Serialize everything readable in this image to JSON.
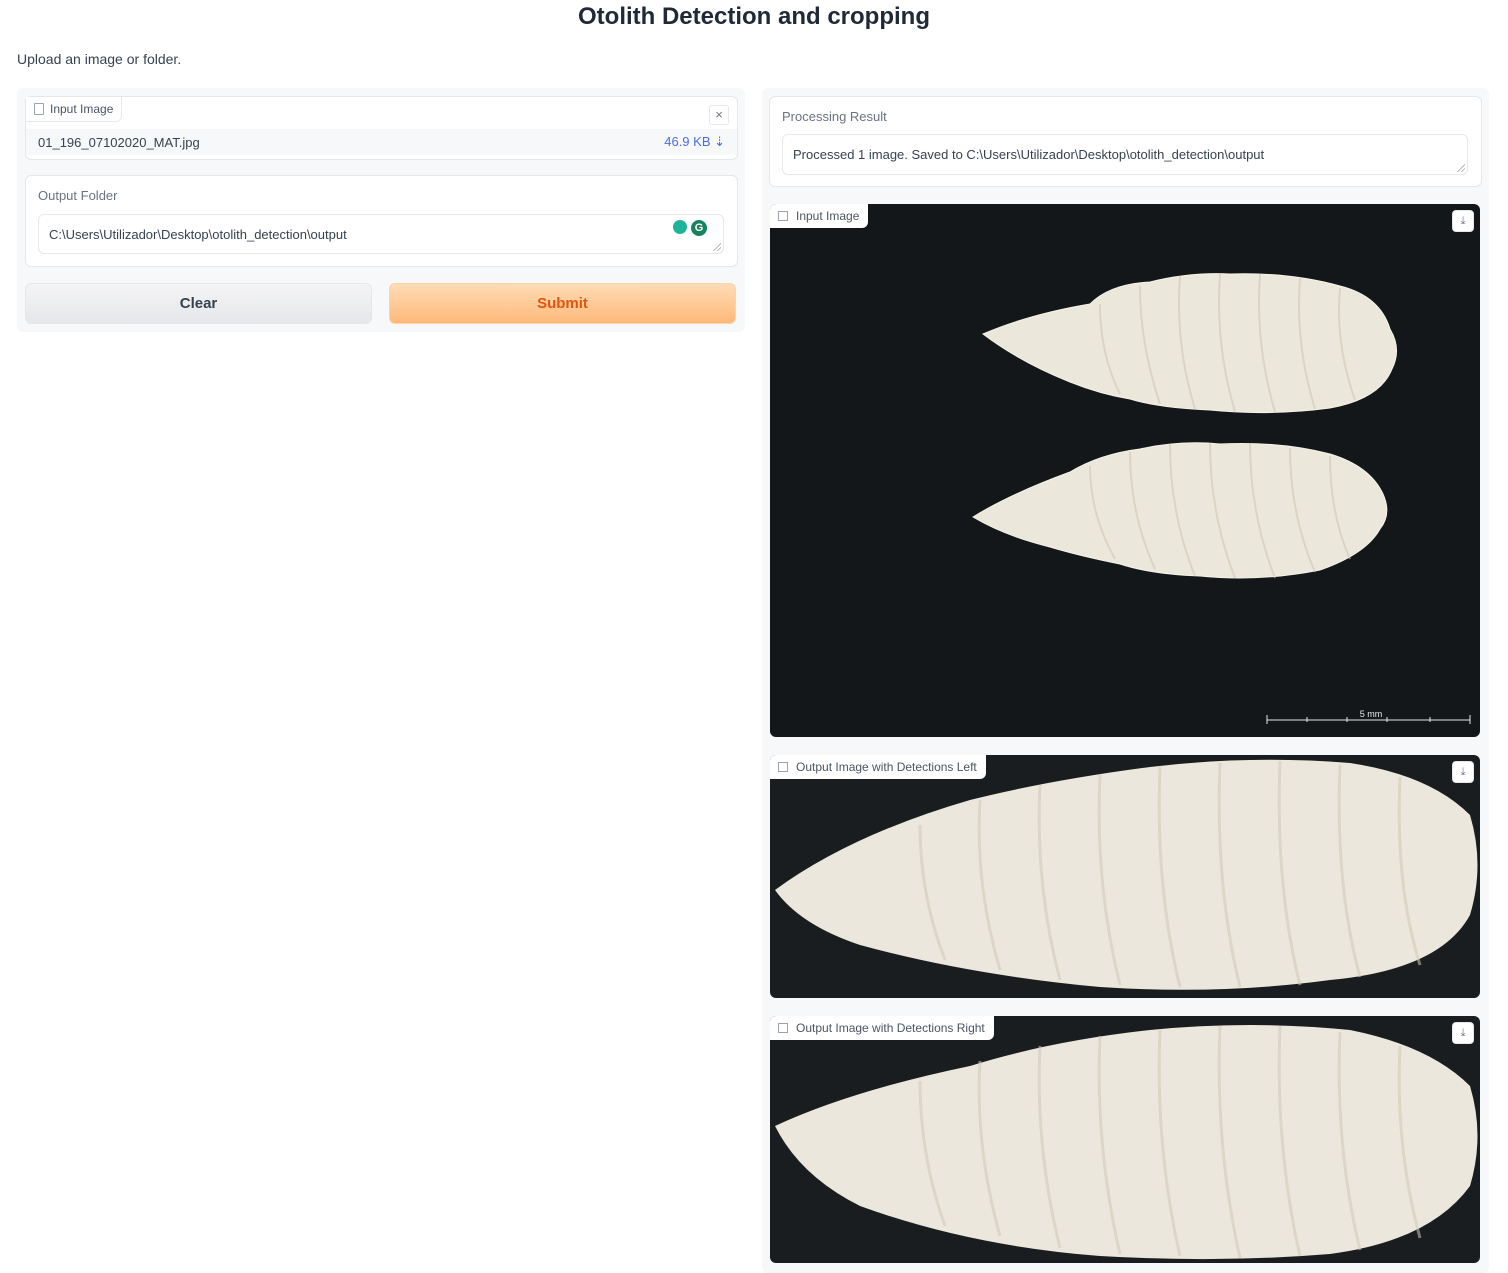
{
  "app": {
    "title": "Otolith Detection and cropping",
    "subtitle": "Upload an image or folder."
  },
  "input_image": {
    "label": "Input Image",
    "file_name": "01_196_07102020_MAT.jpg",
    "file_size": "46.9 KB ⇣",
    "close_glyph": "×"
  },
  "output_folder": {
    "label": "Output Folder",
    "value": "C:\\Users\\Utilizador\\Desktop\\otolith_detection\\output",
    "grammarly_glyph": "G"
  },
  "buttons": {
    "clear": "Clear",
    "submit": "Submit"
  },
  "result": {
    "label": "Processing Result",
    "value": "Processed 1 image. Saved to C:\\Users\\Utilizador\\Desktop\\otolith_detection\\output"
  },
  "images": {
    "input_label": "Input Image",
    "left_label": "Output Image with Detections Left",
    "right_label": "Output Image with Detections Right",
    "download_glyph": "⤓",
    "scale_bar_text": "5 mm"
  },
  "colors": {
    "accent": "#e2550f",
    "submit_bg": "#fdb97a",
    "link": "#4a6ee0",
    "photo_bg": "#14171a",
    "otolith": "#ece8dc"
  }
}
